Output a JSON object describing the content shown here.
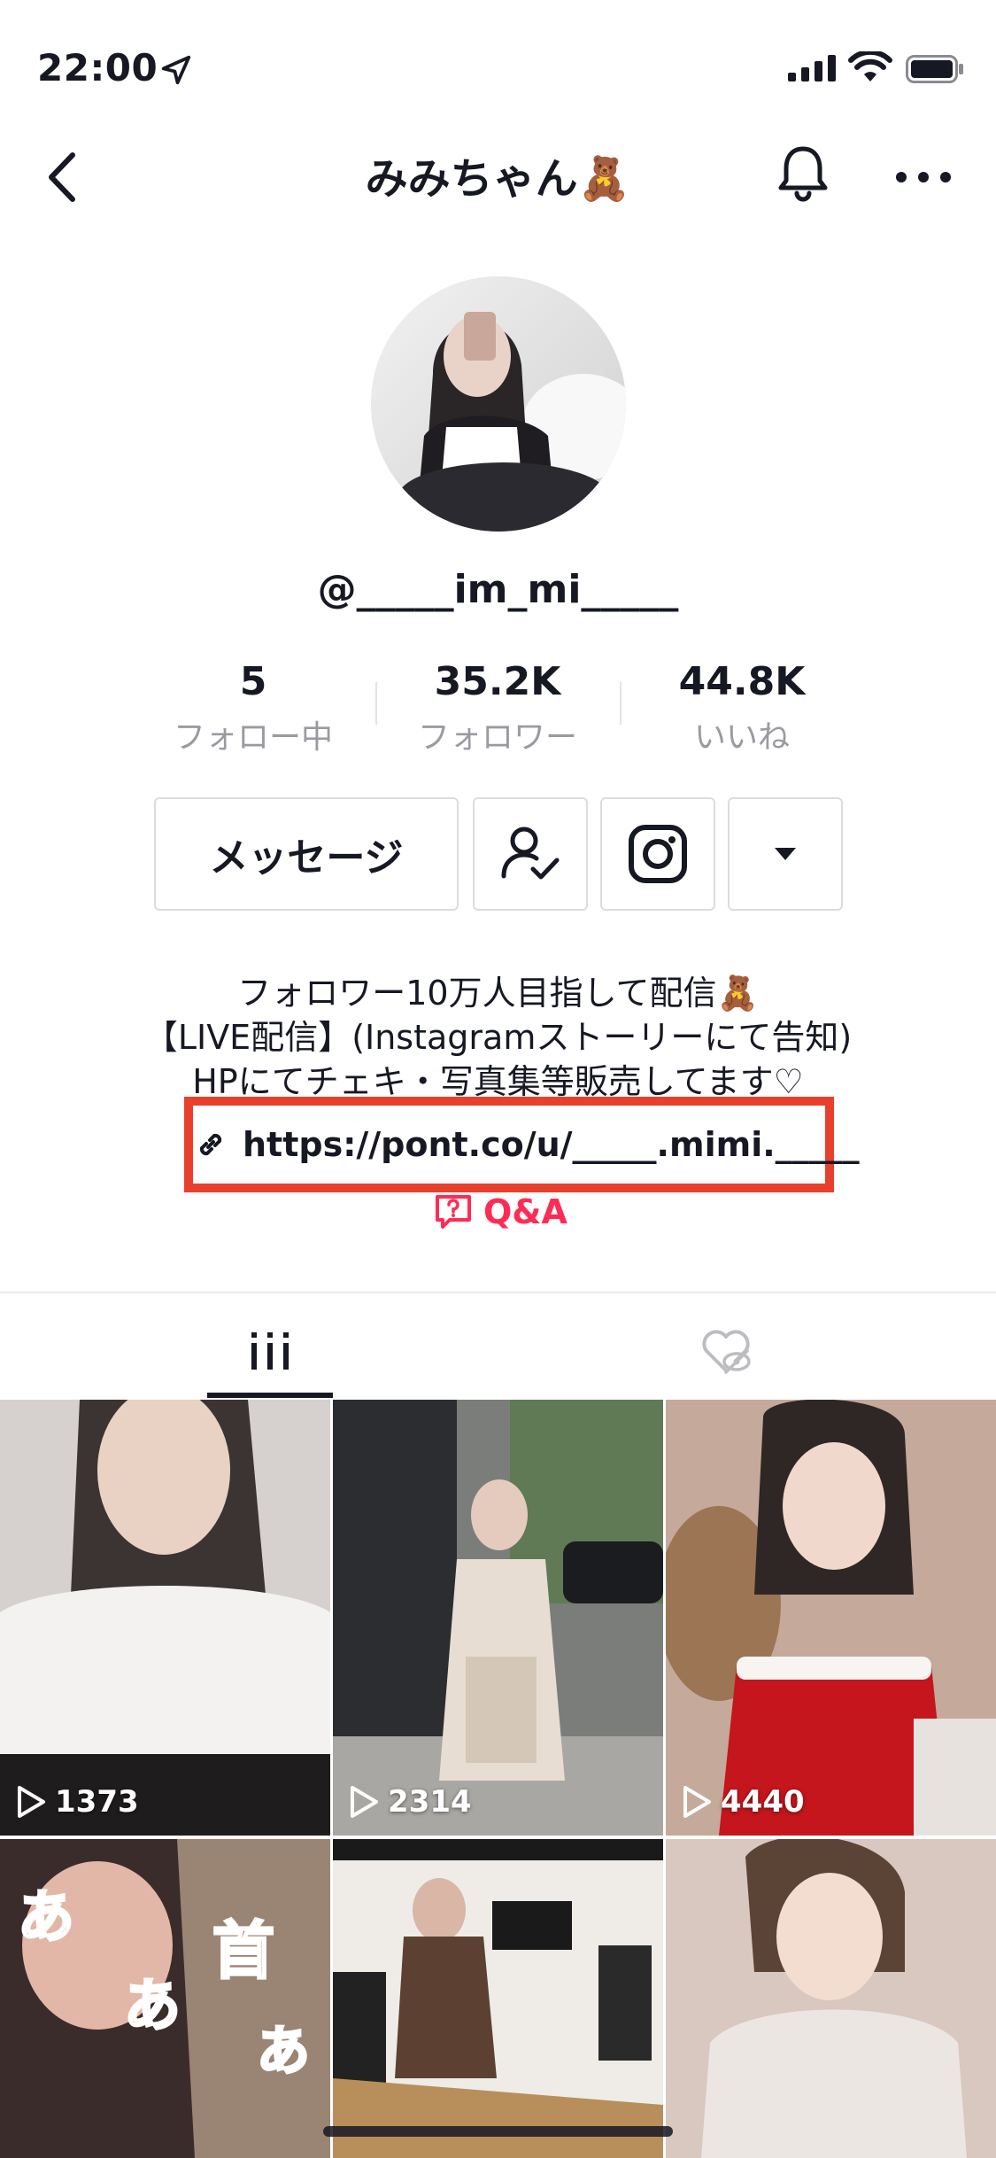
{
  "status_bar": {
    "time": "22:00"
  },
  "header": {
    "title": "みみちゃん🧸"
  },
  "profile": {
    "username": "@_____im_mi_____",
    "stats": [
      {
        "value": "5",
        "label": "フォロー中"
      },
      {
        "value": "35.2K",
        "label": "フォロワー"
      },
      {
        "value": "44.8K",
        "label": "いいね"
      }
    ]
  },
  "actions": {
    "message_label": "メッセージ"
  },
  "bio": {
    "line1": "フォロワー10万人目指して配信🧸",
    "line2": "【LIVE配信】(Instagramストーリーにて告知)",
    "line3": "HPにてチェキ・写真集等販売してます♡",
    "link": "https://pont.co/u/_____.mimi._____",
    "qa": "Q&A"
  },
  "videos": [
    {
      "views": "1373"
    },
    {
      "views": "2314"
    },
    {
      "views": "4440"
    },
    {
      "views": ""
    },
    {
      "views": ""
    },
    {
      "views": ""
    }
  ],
  "colors": {
    "accent": "#fe2c55",
    "highlight_box": "#e8402d",
    "text": "#161823",
    "muted": "#9a9ba1"
  }
}
